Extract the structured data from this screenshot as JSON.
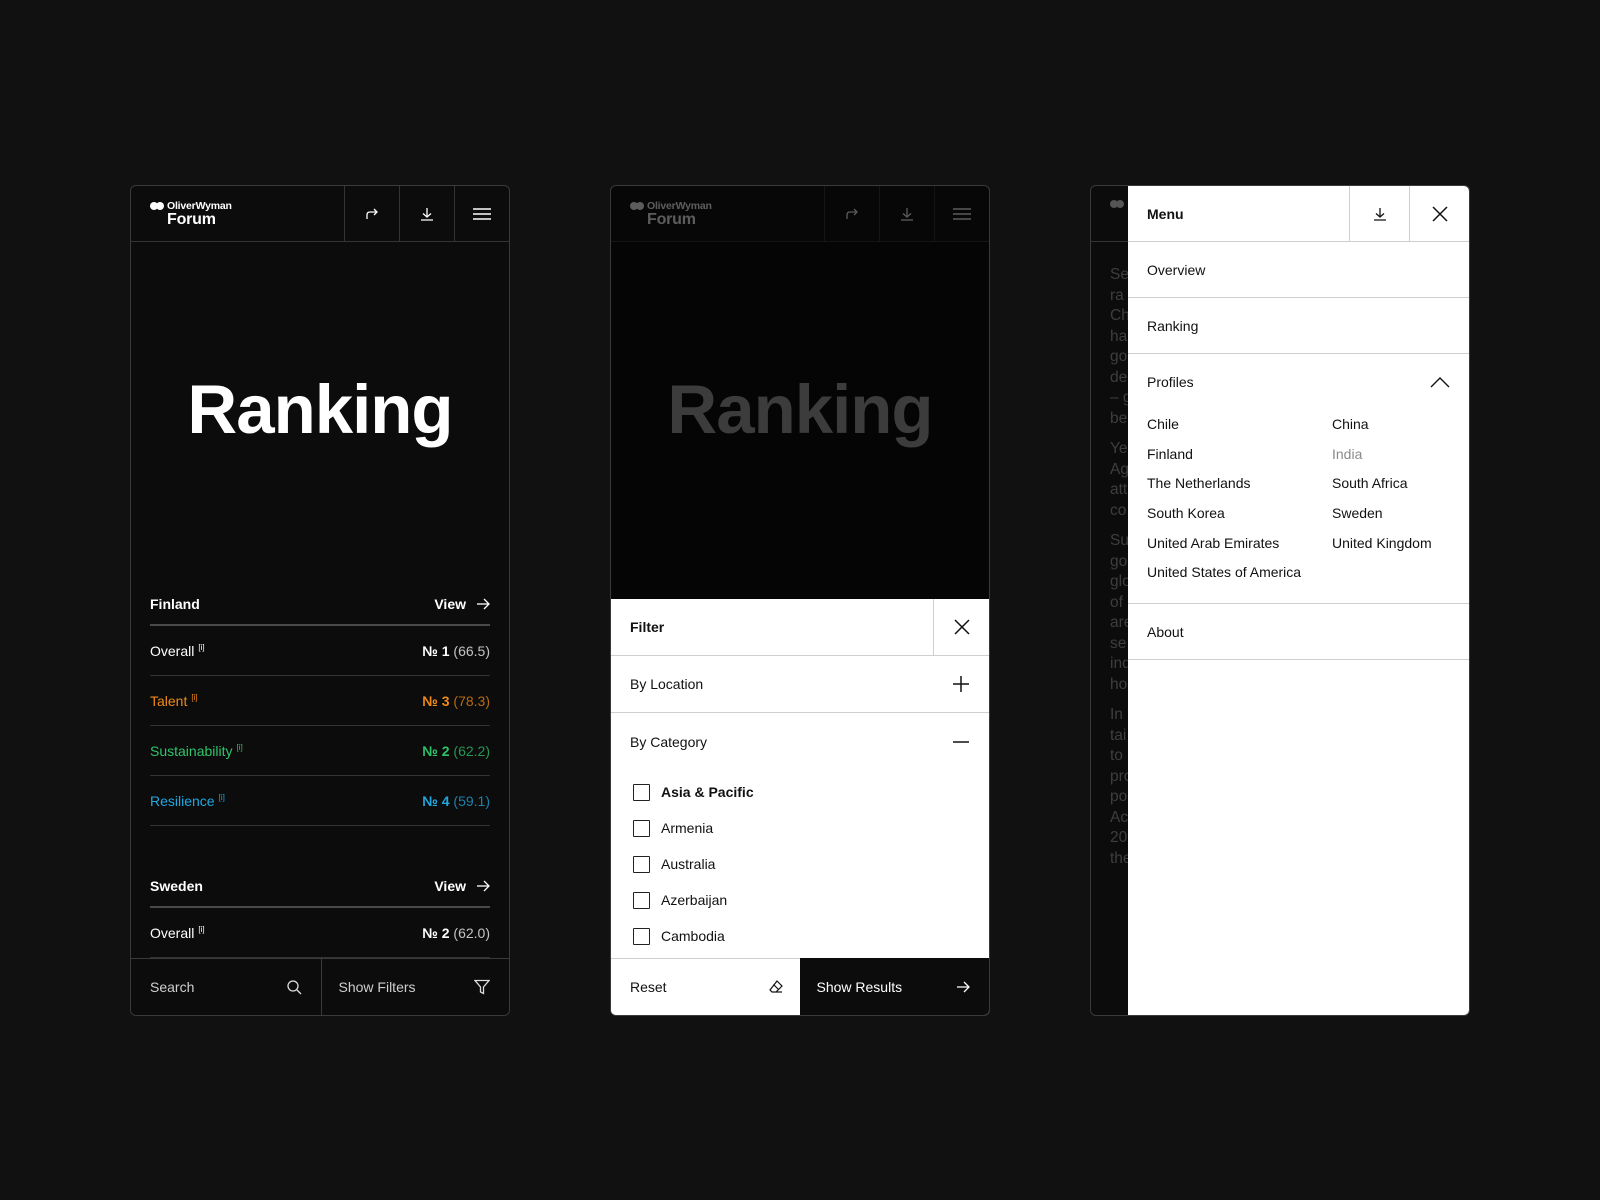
{
  "brand": {
    "name_top": "OliverWyman",
    "name_bottom": "Forum"
  },
  "panel1": {
    "hero_title": "Ranking",
    "sections": [
      {
        "country": "Finland",
        "view_label": "View",
        "rows": [
          {
            "label": "Overall",
            "info": "[i]",
            "rank": "№ 1",
            "score": "(66.5)",
            "color": "#ffffff"
          },
          {
            "label": "Talent",
            "info": "[i]",
            "rank": "№ 3",
            "score": "(78.3)",
            "color": "#ef8a17"
          },
          {
            "label": "Sustainability",
            "info": "[i]",
            "rank": "№ 2",
            "score": "(62.2)",
            "color": "#2fc46a"
          },
          {
            "label": "Resilience",
            "info": "[i]",
            "rank": "№ 4",
            "score": "(59.1)",
            "color": "#22a8df"
          }
        ]
      },
      {
        "country": "Sweden",
        "view_label": "View",
        "rows": [
          {
            "label": "Overall",
            "info": "[i]",
            "rank": "№ 2",
            "score": "(62.0)",
            "color": "#ffffff"
          }
        ]
      }
    ],
    "search_label": "Search",
    "filters_label": "Show Filters"
  },
  "panel2": {
    "hero_title": "Ranking",
    "filter_title": "Filter",
    "by_location": "By Location",
    "by_category": "By Category",
    "category_items": [
      "Asia & Pacific",
      "Armenia",
      "Australia",
      "Azerbaijan",
      "Cambodia"
    ],
    "reset_label": "Reset",
    "show_results_label": "Show Results"
  },
  "panel3": {
    "bg_letters": [
      "Se",
      "ra",
      "Ch",
      "ha",
      "go",
      "de",
      "– g",
      "be",
      "Ye",
      "Ag",
      "att",
      "co",
      "Su",
      "go",
      "glo",
      "of",
      "are",
      "se",
      "ind",
      "ho",
      "In",
      "tai",
      "to",
      "pro",
      "po",
      "Ac",
      "20",
      "the"
    ],
    "menu_title": "Menu",
    "items": {
      "overview": "Overview",
      "ranking": "Ranking",
      "profiles": "Profiles",
      "about": "About"
    },
    "countries": [
      {
        "name": "Chile",
        "muted": false
      },
      {
        "name": "China",
        "muted": false
      },
      {
        "name": "Finland",
        "muted": false
      },
      {
        "name": "India",
        "muted": true
      },
      {
        "name": "The Netherlands",
        "muted": false
      },
      {
        "name": "South Africa",
        "muted": false
      },
      {
        "name": "South Korea",
        "muted": false
      },
      {
        "name": "Sweden",
        "muted": false
      },
      {
        "name": "United Arab Emirates",
        "muted": false
      },
      {
        "name": "United Kingdom",
        "muted": false
      },
      {
        "name": "United States of America",
        "muted": false
      }
    ]
  },
  "icons": [
    "share-icon",
    "download-icon",
    "menu-icon",
    "arrow-right-icon",
    "search-icon",
    "filter-icon",
    "close-icon",
    "plus-icon",
    "minus-icon",
    "eraser-icon",
    "chevron-up-icon"
  ]
}
